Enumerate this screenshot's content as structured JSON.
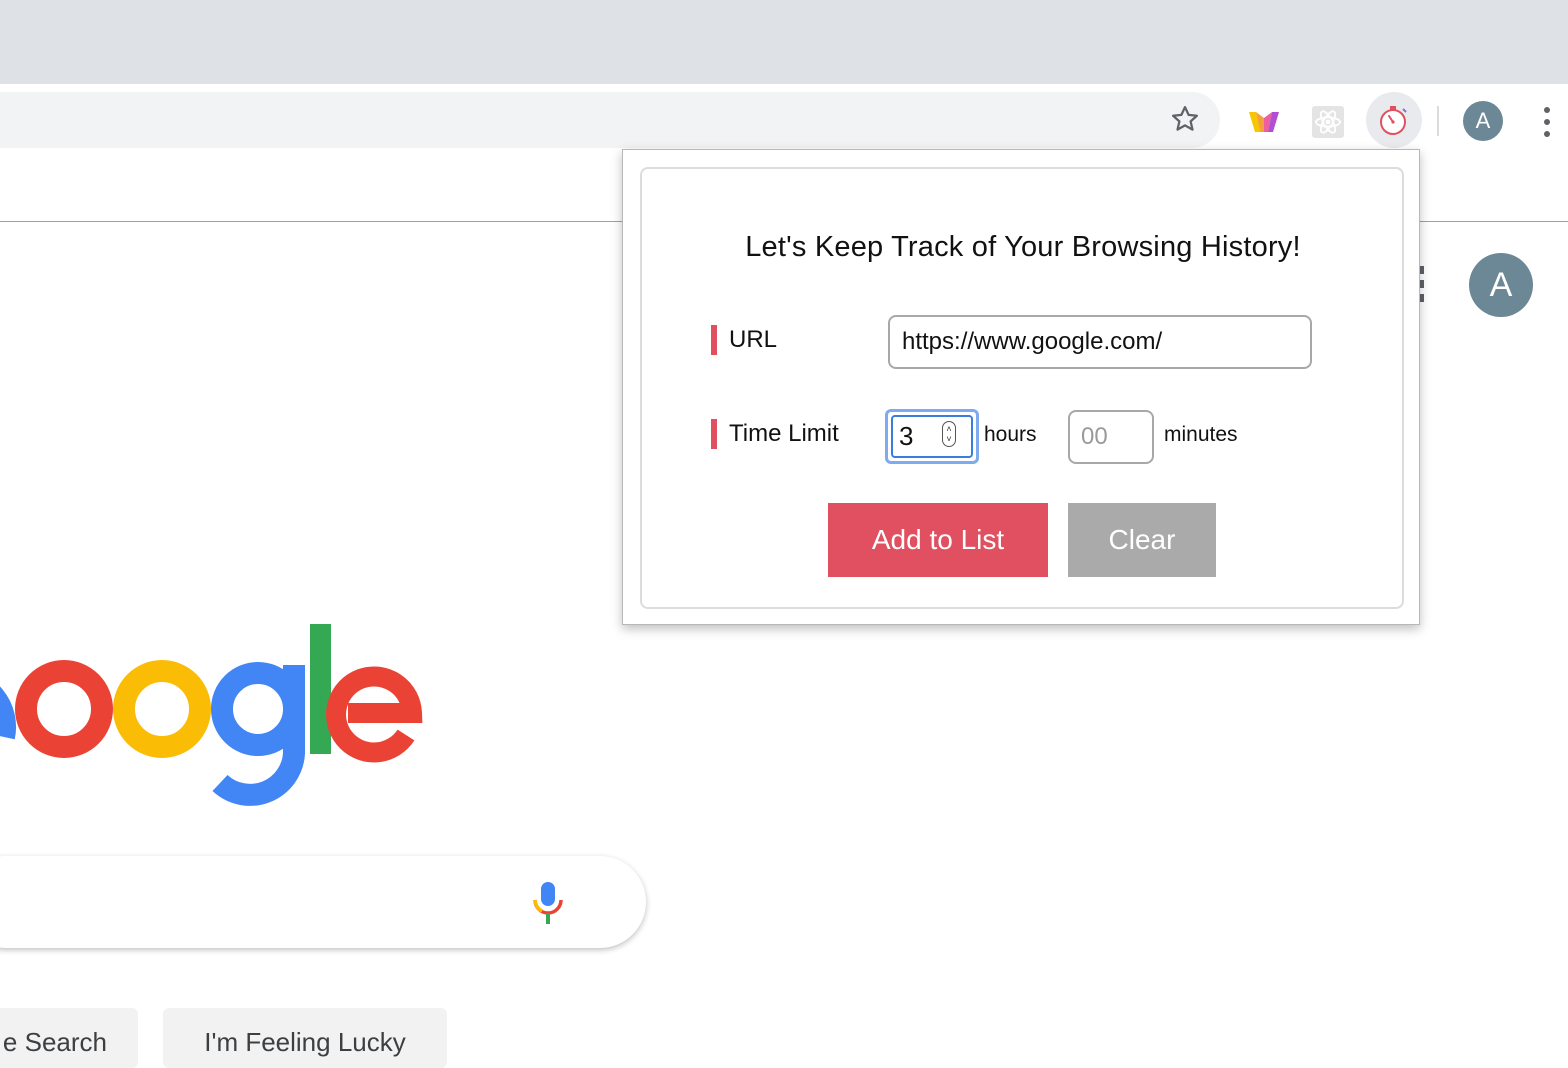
{
  "browser": {
    "star_icon": "star-outline-icon",
    "extensions": [
      {
        "name": "w-extension-icon"
      },
      {
        "name": "react-atom-icon"
      },
      {
        "name": "stopwatch-icon"
      }
    ],
    "profile_initial": "A",
    "menu_icon": "three-dot-menu-icon"
  },
  "google": {
    "avatar_initial": "A",
    "logo_partial": "oogle",
    "search_button": "e Search",
    "lucky_button": "I'm Feeling Lucky",
    "colors": {
      "blue": "#4285F4",
      "red": "#EA4335",
      "yellow": "#FBBC05",
      "green": "#34A853"
    }
  },
  "popup": {
    "title": "Let's Keep Track of Your Browsing History!",
    "url_label": "URL",
    "url_value": "https://www.google.com/",
    "time_label": "Time Limit",
    "hours_value": "3",
    "hours_unit": "hours",
    "minutes_placeholder": "00",
    "minutes_unit": "minutes",
    "add_button": "Add to List",
    "clear_button": "Clear",
    "accent_color": "#E05060",
    "clear_color": "#AAAAAA"
  }
}
